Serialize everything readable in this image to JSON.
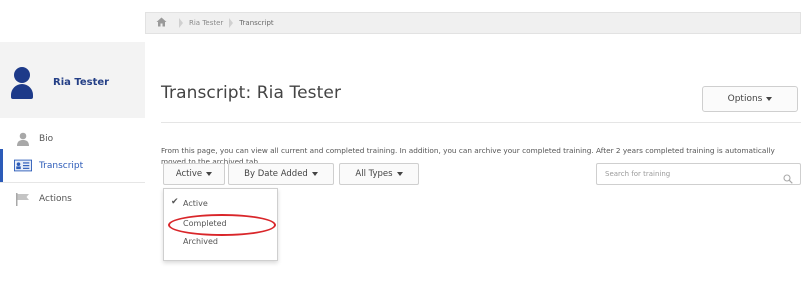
{
  "breadcrumb": {
    "home_icon": "home-icon",
    "items": [
      "Ria Tester",
      "Transcript"
    ]
  },
  "sidebar": {
    "profile_name": "Ria Tester",
    "items": [
      {
        "label": "Bio",
        "icon": "person-icon"
      },
      {
        "label": "Transcript",
        "icon": "transcript-icon"
      },
      {
        "label": "Actions",
        "icon": "flag-icon"
      }
    ],
    "active_item": "Transcript"
  },
  "main": {
    "title": "Transcript: Ria Tester",
    "options_label": "Options",
    "description": "From this page, you can view all current and completed training. In addition, you can archive your completed training. After 2 years completed training is automatically moved to the archived tab.",
    "filters": {
      "status_label": "Active",
      "sort_label": "By Date Added",
      "type_label": "All Types"
    },
    "search": {
      "placeholder": "Search for training"
    },
    "status_dropdown": {
      "options": [
        "Active",
        "Completed",
        "Archived"
      ],
      "selected": "Active",
      "highlighted": "Completed"
    }
  },
  "colors": {
    "accent": "#2c5bb8",
    "profile_name": "#243f86",
    "highlight_ring": "#d9262a"
  }
}
